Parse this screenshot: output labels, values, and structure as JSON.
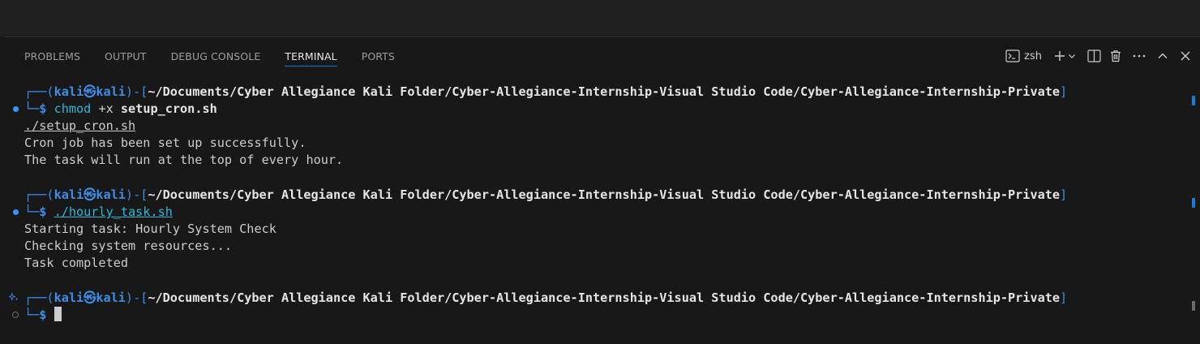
{
  "panel": {
    "tabs": [
      {
        "label": "PROBLEMS",
        "active": false
      },
      {
        "label": "OUTPUT",
        "active": false
      },
      {
        "label": "DEBUG CONSOLE",
        "active": false
      },
      {
        "label": "TERMINAL",
        "active": true
      },
      {
        "label": "PORTS",
        "active": false
      }
    ],
    "actions": {
      "shell_name": "zsh",
      "icons": [
        "terminal-icon",
        "plus-icon",
        "chevron-down-icon",
        "split-icon",
        "trash-icon",
        "more-icon",
        "chevron-up-icon",
        "close-icon"
      ]
    }
  },
  "terminal": {
    "prompt_user": "kali",
    "prompt_at": "㉿",
    "prompt_host": "kali",
    "prompt_path": "~/Documents/Cyber Allegiance Kali Folder/Cyber-Allegiance-Internship-Visual Studio Code/Cyber-Allegiance-Internship-Private",
    "blocks": [
      {
        "command_name": "chmod",
        "command_args": " +x ",
        "command_file": "setup_cron.sh",
        "status": "success",
        "output": [
          "./setup_cron.sh",
          "Cron job has been set up successfully.",
          "The task will run at the top of every hour."
        ]
      },
      {
        "command_name": "./hourly_task.sh",
        "status": "success",
        "output": [
          "Starting task: Hourly System Check",
          "Checking system resources...",
          "Task completed"
        ]
      },
      {
        "status": "current"
      }
    ]
  },
  "colors": {
    "accent": "#0078d4",
    "prompt_blue": "#3b8eea",
    "command_cyan": "#29b8db",
    "panel_bg": "#181818"
  }
}
